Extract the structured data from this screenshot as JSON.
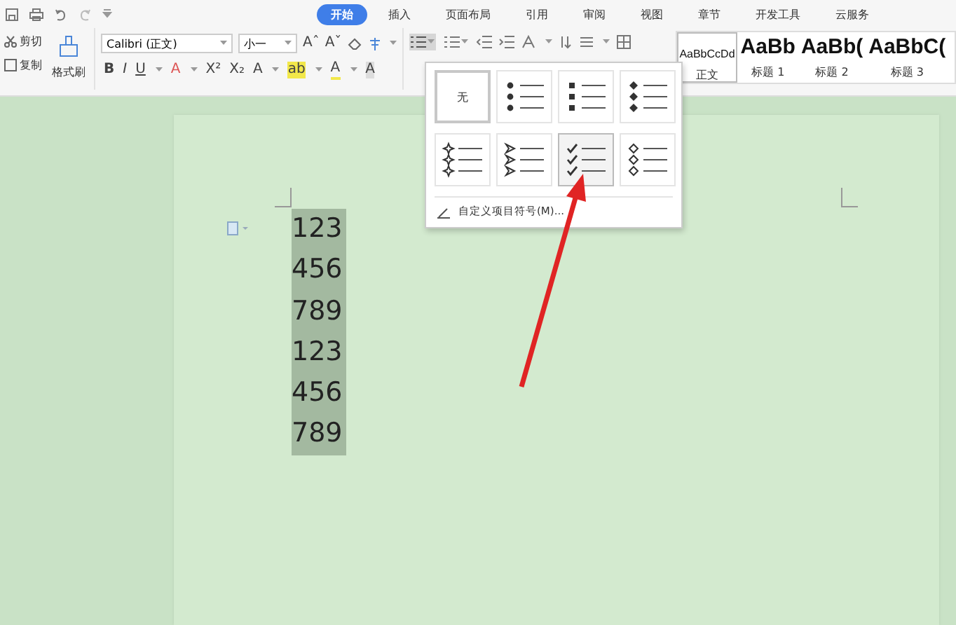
{
  "menu_tabs": [
    {
      "label": "开始",
      "selected": true
    },
    {
      "label": "插入",
      "selected": false
    },
    {
      "label": "页面布局",
      "selected": false
    },
    {
      "label": "引用",
      "selected": false
    },
    {
      "label": "审阅",
      "selected": false
    },
    {
      "label": "视图",
      "selected": false
    },
    {
      "label": "章节",
      "selected": false
    },
    {
      "label": "开发工具",
      "selected": false
    },
    {
      "label": "云服务",
      "selected": false
    }
  ],
  "clipboard": {
    "cut": "剪切",
    "copy": "复制",
    "format_painter": "格式刷"
  },
  "font": {
    "family": "Calibri (正文)",
    "size": "小一",
    "size_buttons": [
      "Aˆ",
      "Aˇ"
    ],
    "format_buttons": [
      "B",
      "I",
      "U",
      "A",
      "X²",
      "X₂",
      "A",
      "ab",
      "A",
      "A"
    ]
  },
  "styles": [
    {
      "preview": "AaBbCcDd",
      "name": "正文",
      "selected": true
    },
    {
      "preview": "AaBb",
      "name": "标题 1",
      "selected": false
    },
    {
      "preview": "AaBb(",
      "name": "标题 2",
      "selected": false
    },
    {
      "preview": "AaBbC(",
      "name": "标题 3",
      "selected": false
    }
  ],
  "bullet_menu": {
    "options": [
      {
        "kind": "none",
        "label": "无",
        "selected": true,
        "hovered": false
      },
      {
        "kind": "dot",
        "selected": false,
        "hovered": false
      },
      {
        "kind": "square",
        "selected": false,
        "hovered": false
      },
      {
        "kind": "diamond",
        "selected": false,
        "hovered": false
      },
      {
        "kind": "star",
        "selected": false,
        "hovered": false
      },
      {
        "kind": "arrow",
        "selected": false,
        "hovered": false
      },
      {
        "kind": "check",
        "selected": false,
        "hovered": true
      },
      {
        "kind": "hollow",
        "selected": false,
        "hovered": false
      }
    ],
    "footer": "自定义项目符号(M)..."
  },
  "document": {
    "lines": [
      {
        "text": "123",
        "selected": true
      },
      {
        "text": "456",
        "selected": true
      },
      {
        "text": "789",
        "selected": true
      },
      {
        "text": "123",
        "selected": true
      },
      {
        "text": "456",
        "selected": true
      },
      {
        "text": "789",
        "selected": true
      }
    ]
  }
}
